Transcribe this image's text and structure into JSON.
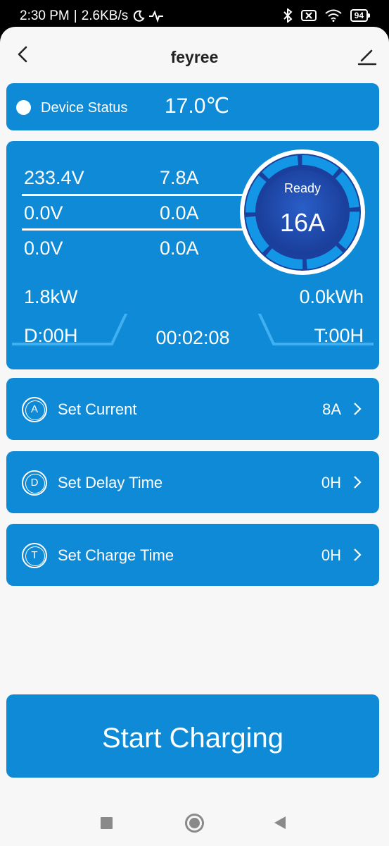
{
  "statusbar": {
    "time": "2:30 PM",
    "separator": "|",
    "speed": "2.6KB/s",
    "moon_icon": "moon-icon",
    "pulse_icon": "pulse-icon",
    "bluetooth_icon": "bluetooth-icon",
    "wifi_icon": "wifi-icon",
    "battery": "94"
  },
  "header": {
    "title": "feyree"
  },
  "device_status": {
    "label": "Device Status",
    "temperature": "17.0℃"
  },
  "readings": {
    "row1": {
      "voltage": "233.4V",
      "current": "7.8A"
    },
    "row2": {
      "voltage": "0.0V",
      "current": "0.0A"
    },
    "row3": {
      "voltage": "0.0V",
      "current": "0.0A"
    },
    "power": "1.8kW",
    "energy": "0.0kWh",
    "delay": "D:00H",
    "elapsed": "00:02:08",
    "charge_time": "T:00H"
  },
  "gauge": {
    "state": "Ready",
    "amps": "16A"
  },
  "settings": [
    {
      "icon_letter": "A",
      "label": "Set Current",
      "value": "8A"
    },
    {
      "icon_letter": "D",
      "label": "Set Delay Time",
      "value": "0H"
    },
    {
      "icon_letter": "T",
      "label": "Set Charge Time",
      "value": "0H"
    }
  ],
  "actions": {
    "start_label": "Start Charging"
  },
  "colors": {
    "accent": "#0f8ad6",
    "panel": "#0a80cf",
    "gauge_ring": "#1e50b4",
    "background": "#f7f7f7"
  }
}
